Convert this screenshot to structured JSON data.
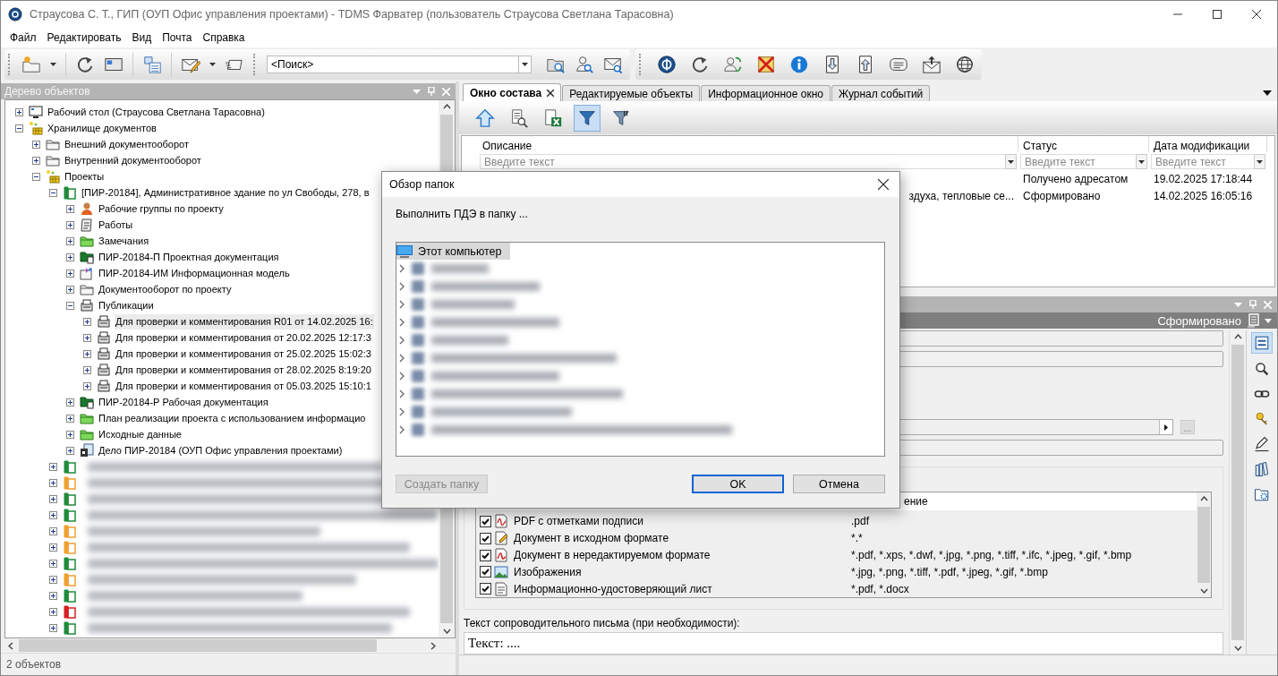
{
  "window": {
    "title": "Страусова С. Т., ГИП (ОУП Офис управления проектами) - TDMS Фарватер (пользователь Страусова Светлана Тарасовна)"
  },
  "menu": [
    "Файл",
    "Редактировать",
    "Вид",
    "Почта",
    "Справка"
  ],
  "toolbar": {
    "search": {
      "value": "<Поиск>"
    }
  },
  "tree_panel": {
    "title": "Дерево объектов",
    "status": "2 объектов",
    "nodes": [
      {
        "label": "Рабочий стол (Страусова Светлана Тарасовна)",
        "kind": "desktop",
        "expanded": false,
        "selected": false
      },
      {
        "label": "Хранилище документов",
        "kind": "storage",
        "expanded": true,
        "selected": false,
        "children": [
          {
            "label": "Внешний документооборот",
            "kind": "folder",
            "expanded": false,
            "selected": false
          },
          {
            "label": "Внутренний документооборот",
            "kind": "folder",
            "expanded": false,
            "selected": false
          },
          {
            "label": "Проекты",
            "kind": "storage",
            "expanded": true,
            "selected": false,
            "children": [
              {
                "label": "[ПИР-20184], Административное здание по ул Свободы, 278, в",
                "kind": "project",
                "color": "#1f8b3b",
                "expanded": true,
                "selected": false,
                "children": [
                  {
                    "label": "Рабочие группы по проекту",
                    "kind": "group",
                    "expanded": false,
                    "selected": false
                  },
                  {
                    "label": "Работы",
                    "kind": "works",
                    "expanded": false,
                    "selected": false
                  },
                  {
                    "label": "Замечания",
                    "kind": "green-folder",
                    "expanded": false,
                    "selected": false
                  },
                  {
                    "label": "ПИР-20184-П Проектная документация",
                    "kind": "doc-folder",
                    "expanded": false,
                    "selected": false
                  },
                  {
                    "label": "ПИР-20184-ИМ Информационная модель",
                    "kind": "model",
                    "expanded": false,
                    "selected": false
                  },
                  {
                    "label": "Документооборот по проекту",
                    "kind": "folder",
                    "expanded": false,
                    "selected": false
                  },
                  {
                    "label": "Публикации",
                    "kind": "publication",
                    "expanded": true,
                    "selected": false,
                    "children": [
                      {
                        "label": "Для проверки и комментирования R01 от 14.02.2025 16:",
                        "kind": "publication",
                        "expanded": false,
                        "selected": true
                      },
                      {
                        "label": "Для проверки и комментирования от 20.02.2025 12:17:3",
                        "kind": "publication",
                        "expanded": false,
                        "selected": false
                      },
                      {
                        "label": "Для проверки и комментирования от 25.02.2025 15:02:3",
                        "kind": "publication",
                        "expanded": false,
                        "selected": false
                      },
                      {
                        "label": "Для проверки и комментирования от 28.02.2025 8:19:20",
                        "kind": "publication",
                        "expanded": false,
                        "selected": false
                      },
                      {
                        "label": "Для проверки и комментирования от 05.03.2025 15:10:1",
                        "kind": "publication",
                        "expanded": false,
                        "selected": false
                      }
                    ]
                  },
                  {
                    "label": "ПИР-20184-Р Рабочая документация",
                    "kind": "doc-folder",
                    "expanded": false,
                    "selected": false
                  },
                  {
                    "label": "План реализации проекта с использованием информацио",
                    "kind": "green-folder",
                    "expanded": false,
                    "selected": false
                  },
                  {
                    "label": "Исходные данные",
                    "kind": "green-folder",
                    "expanded": false,
                    "selected": false
                  },
                  {
                    "label": "Дело  ПИР-20184 (ОУП Офис управления проектами)",
                    "kind": "case",
                    "expanded": false,
                    "selected": false
                  }
                ]
              },
              {
                "kind": "blurred",
                "color": "#1f8b3b",
                "expanded": false,
                "selected": false
              },
              {
                "kind": "blurred",
                "color": "#f0a030",
                "expanded": false,
                "selected": false
              },
              {
                "kind": "blurred",
                "color": "#1f8b3b",
                "expanded": false,
                "selected": false
              },
              {
                "kind": "blurred",
                "color": "#1f8b3b",
                "expanded": false,
                "selected": false
              },
              {
                "kind": "blurred",
                "color": "#f0a030",
                "expanded": false,
                "selected": false
              },
              {
                "kind": "blurred",
                "color": "#f0a030",
                "expanded": false,
                "selected": false
              },
              {
                "kind": "blurred",
                "color": "#1f8b3b",
                "expanded": false,
                "selected": false
              },
              {
                "kind": "blurred",
                "color": "#f0a030",
                "expanded": false,
                "selected": false
              },
              {
                "kind": "blurred",
                "color": "#1f8b3b",
                "expanded": false,
                "selected": false
              },
              {
                "kind": "blurred",
                "color": "#d42020",
                "expanded": false,
                "selected": false
              },
              {
                "kind": "blurred",
                "color": "#1f8b3b",
                "expanded": false,
                "selected": false
              }
            ]
          }
        ]
      }
    ]
  },
  "tabs": [
    {
      "label": "Окно состава",
      "selected": true
    },
    {
      "label": "Редактируемые объекты",
      "selected": false
    },
    {
      "label": "Информационное окно",
      "selected": false
    },
    {
      "label": "Журнал событий",
      "selected": false
    }
  ],
  "table": {
    "filter_on": true,
    "columns": [
      {
        "label": "Описание",
        "placeholder": "Введите текст"
      },
      {
        "label": "Статус",
        "placeholder": "Введите текст"
      },
      {
        "label": "Дата модификации",
        "placeholder": "Введите текст"
      }
    ],
    "rows": [
      {
        "status": "Получено адресатом",
        "modified": "19.02.2025 17:18:44"
      },
      {
        "description": "здуха, тепловые се...",
        "status": "Сформировано",
        "modified": "14.02.2025 16:05:16"
      }
    ]
  },
  "details": {
    "status": "Сформировано",
    "browse_button": "...",
    "list_header": "ение",
    "file_types": [
      {
        "name": "PDF с отметками подписи",
        "ext": ".pdf",
        "checked": true,
        "kind": "pdf-sign"
      },
      {
        "name": "Документ в исходном формате",
        "ext": "*.*",
        "checked": true,
        "kind": "doc-edit"
      },
      {
        "name": "Документ в нередактируемом формате",
        "ext": "*.pdf, *.xps, *.dwf, *.jpg, *.png, *.tiff, *.ifc,  *.jpeg, *.gif, *.bmp",
        "checked": true,
        "kind": "pdf"
      },
      {
        "name": "Изображения",
        "ext": "*.jpg, *.png, *.tiff, *.pdf,  *.jpeg, *.gif, *.bmp",
        "checked": true,
        "kind": "image"
      },
      {
        "name": "Информационно-удостоверяющий лист",
        "ext": "*.pdf, *.docx",
        "checked": true,
        "kind": "doc"
      }
    ],
    "letter_label": "Текст сопроводительного письма (при необходимости):",
    "letter_text": "Текст: ...."
  },
  "dialog": {
    "title": "Обзор папок",
    "prompt": "Выполнить ПДЭ в папку ...",
    "root": {
      "label": "Этот компьютер",
      "selected": true
    },
    "folders": [
      {
        "kind": "blurred"
      },
      {
        "kind": "blurred"
      },
      {
        "kind": "blurred"
      },
      {
        "kind": "blurred"
      },
      {
        "kind": "blurred"
      },
      {
        "kind": "blurred"
      },
      {
        "kind": "blurred"
      },
      {
        "kind": "blurred"
      },
      {
        "kind": "blurred"
      },
      {
        "kind": "blurred"
      }
    ],
    "buttons": [
      {
        "label": "Создать папку",
        "disabled": true,
        "default": false
      },
      {
        "label": "OK",
        "disabled": false,
        "default": true
      },
      {
        "label": "Отмена",
        "disabled": false,
        "default": false
      }
    ]
  }
}
